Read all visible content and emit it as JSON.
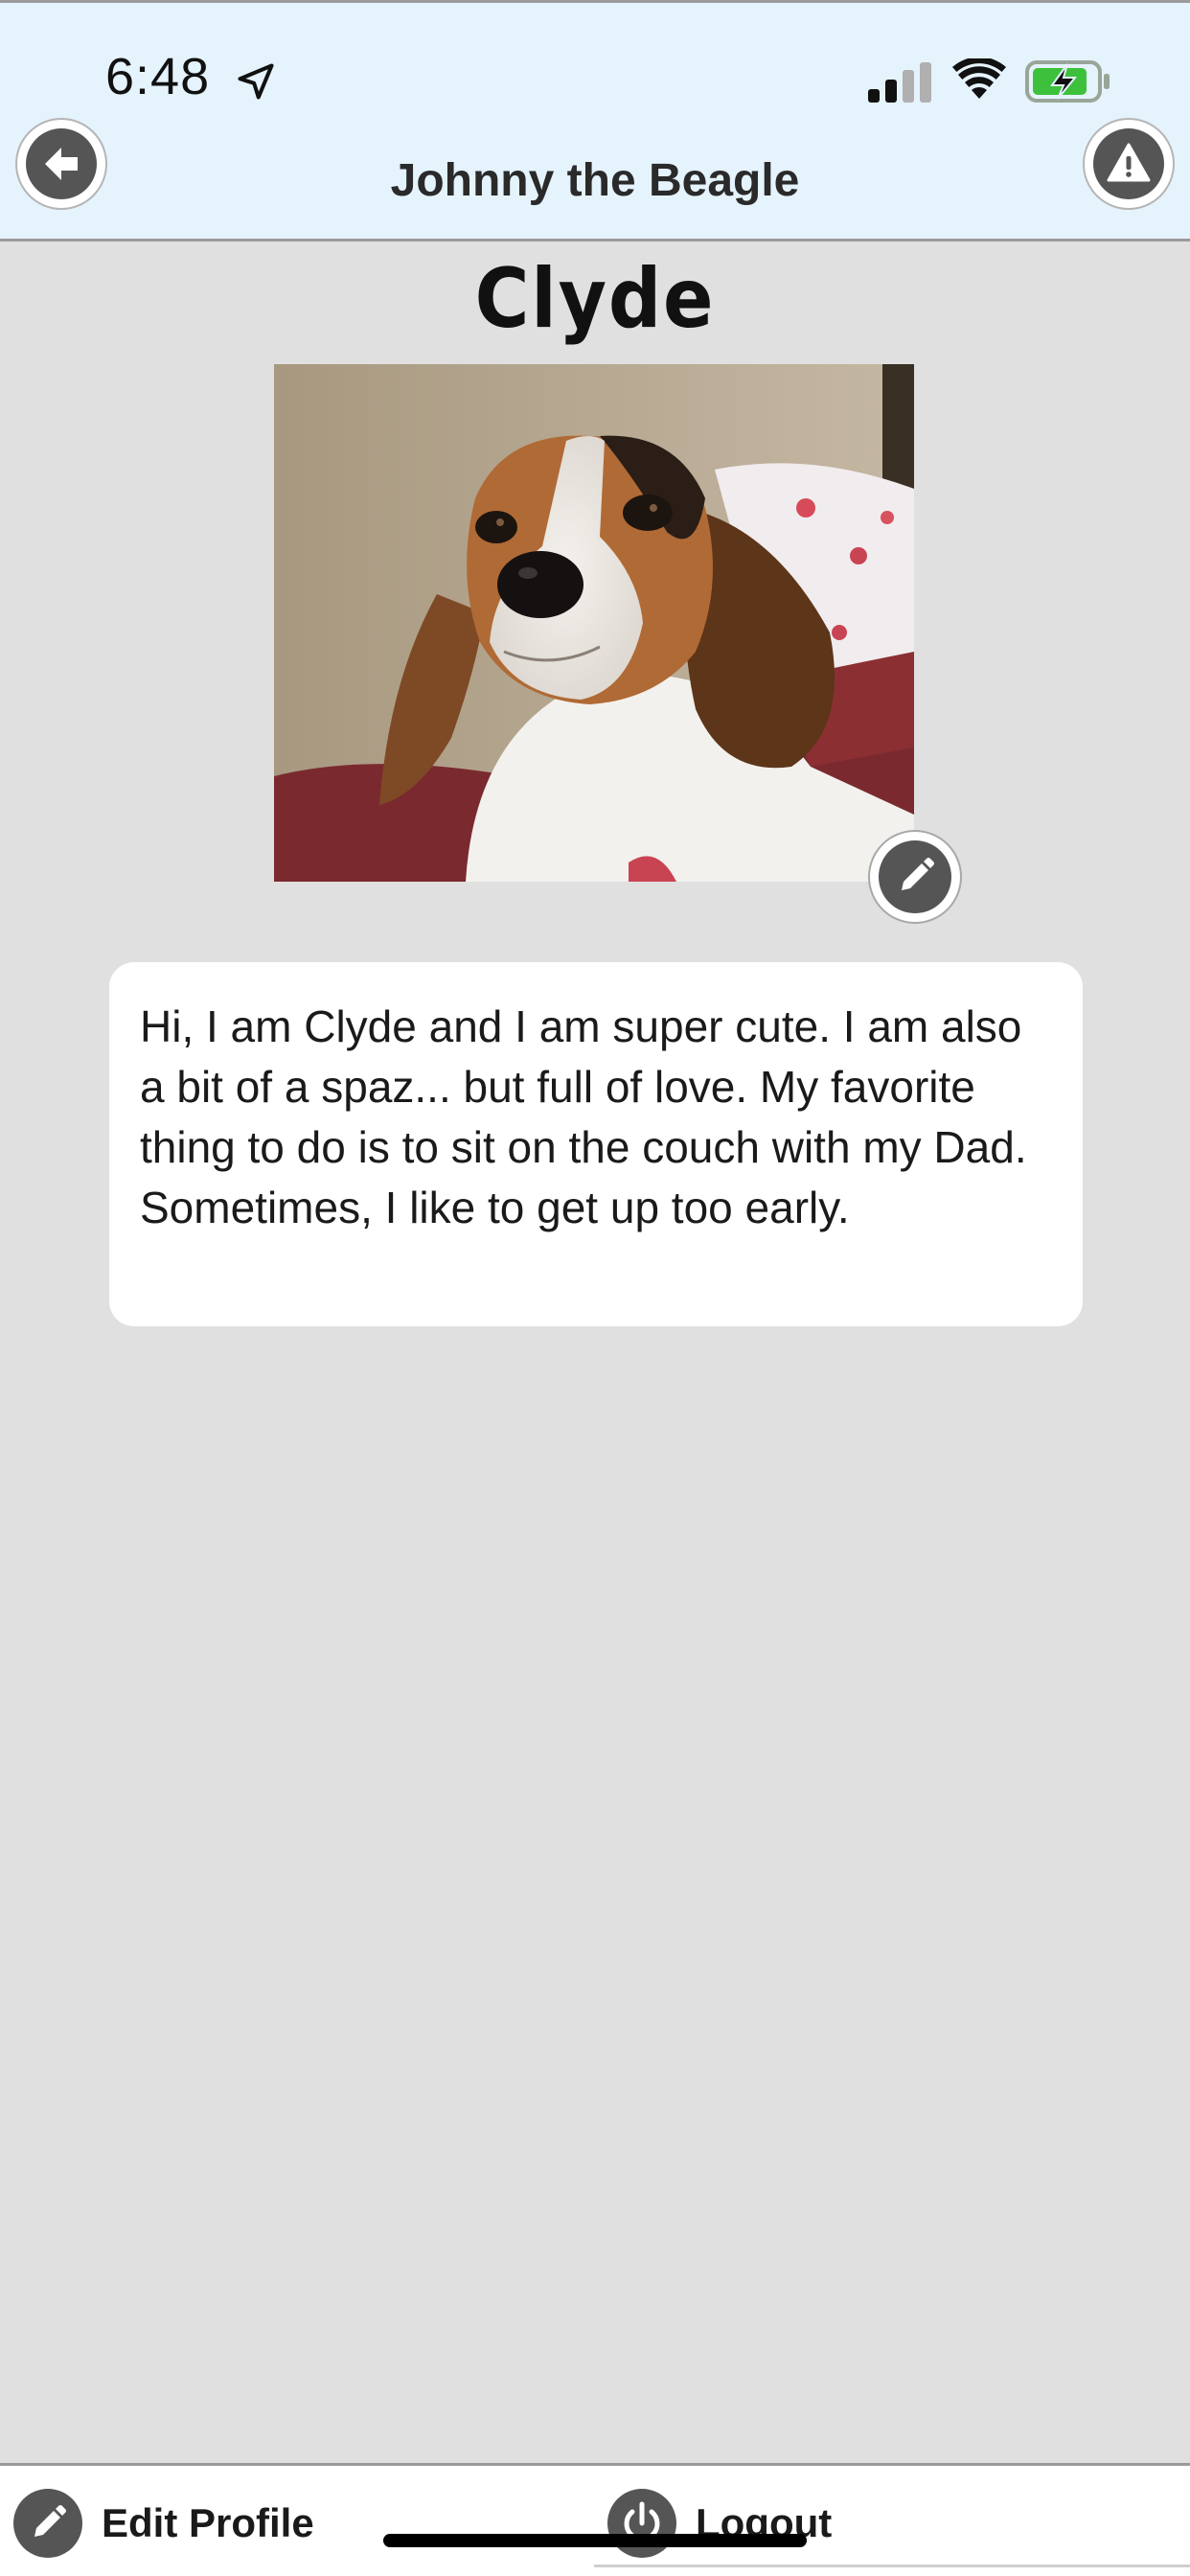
{
  "status_bar": {
    "time": "6:48",
    "icons": [
      "location-arrow-icon",
      "cellular-signal-icon",
      "wifi-icon",
      "battery-charging-icon"
    ]
  },
  "header": {
    "title": "Johnny the Beagle",
    "back_icon": "back-arrow-icon",
    "alert_icon": "warning-icon",
    "background": "#e5f3fd"
  },
  "profile": {
    "name": "Clyde",
    "photo_alt": "Beagle photo",
    "edit_photo_icon": "pencil-icon",
    "bio": "Hi, I am Clyde and I am super cute. I am also a bit of a spaz... but full of love. My favorite thing to do is to sit on the couch with my Dad. Sometimes, I like to get up too early."
  },
  "bottom_bar": {
    "edit_profile_label": "Edit Profile",
    "edit_profile_icon": "pencil-icon",
    "logout_label": "Logout",
    "logout_icon": "power-icon"
  },
  "colors": {
    "page_background": "#e0e0e0",
    "icon_fill": "#555555",
    "battery_green": "#3dc13c"
  }
}
